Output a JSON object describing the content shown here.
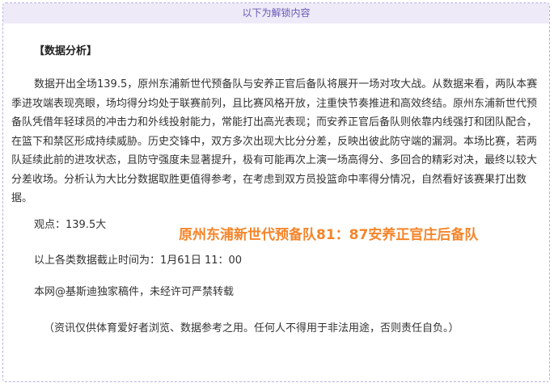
{
  "unlock_header": "以下为解锁内容",
  "section_title": "【数据分析】",
  "analysis_text": "数据开出全场139.5，原州东浦新世代预备队与安养正官后备队将展开一场对攻大战。从数据来看，两队本赛季进攻端表现亮眼，场均得分均处于联赛前列，且比赛风格开放，注重快节奏推进和高效终结。原州东浦新世代预备队凭借年轻球员的冲击力和外线投射能力，常能打出高光表现；而安养正官后备队则依靠内线强打和团队配合，在篮下和禁区形成持续威胁。历史交锋中，双方多次出现大比分分差，反映出彼此防守端的漏洞。本场比赛，若两队延续此前的进攻状态，且防守强度未显著提升，极有可能再次上演一场高得分、多回合的精彩对决，最终以较大分差收场。分析认为大比分数据取胜更值得参考，在考虑到双方员投篮命中率得分情况，自然看好该赛果打出数据。",
  "view_point": "观点：139.5大",
  "score_line": "原州东浦新世代预备队81：87安养正官庄后备队",
  "cutoff_time": "以上各类数据截止时间为：1月61日 11：00",
  "copyright": "本网@基斯迪独家稿件，未经许可严禁转载",
  "disclaimer": "（资讯仅供体育爱好者浏览、数据参考之用。任何人不得用于非法用途，否则责任自负。）",
  "colors": {
    "header_bg": "#eeeaf8",
    "header_text": "#6b59b5",
    "border": "#b9b0df",
    "score_accent": "#f5852a"
  }
}
